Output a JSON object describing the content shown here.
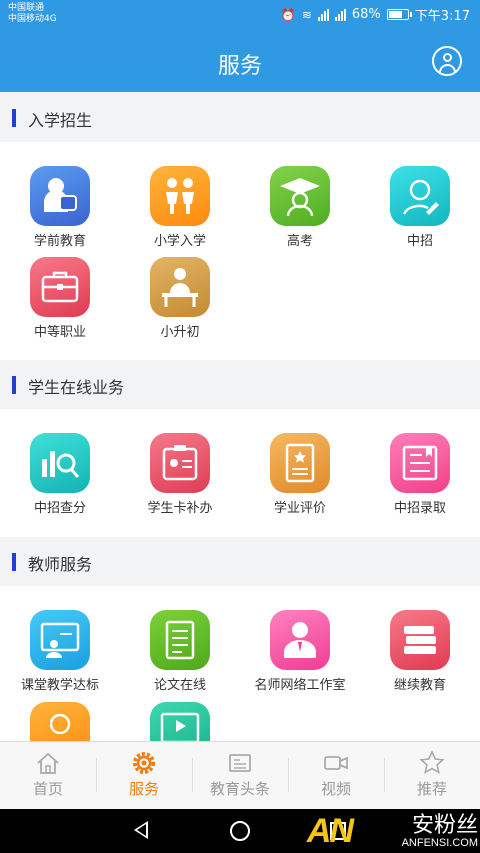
{
  "status_bar": {
    "carrier1": "中国联通",
    "carrier2": "中国移动4G",
    "battery": "68%",
    "time": "下午3:17"
  },
  "header": {
    "title": "服务"
  },
  "sections": [
    {
      "title": "入学招生",
      "items": [
        {
          "label": "学前教育",
          "icon": "preschool-icon",
          "color": "#4a7fe0"
        },
        {
          "label": "小学入学",
          "icon": "pupils-icon",
          "color": "#ffa21f"
        },
        {
          "label": "高考",
          "icon": "graduation-cap-icon",
          "color": "#6cc43a"
        },
        {
          "label": "中招",
          "icon": "pen-person-icon",
          "color": "#1fc8d0"
        },
        {
          "label": "中等职业",
          "icon": "briefcase-icon",
          "color": "#f0576a"
        },
        {
          "label": "小升初",
          "icon": "student-desk-icon",
          "color": "#d5a050"
        }
      ]
    },
    {
      "title": "学生在线业务",
      "items": [
        {
          "label": "中招查分",
          "icon": "score-search-icon",
          "color": "#1fc8c8"
        },
        {
          "label": "学生卡补办",
          "icon": "id-card-icon",
          "color": "#f0576a"
        },
        {
          "label": "学业评价",
          "icon": "certificate-icon",
          "color": "#f0a848"
        },
        {
          "label": "中招录取",
          "icon": "admission-book-icon",
          "color": "#ff5fa2"
        }
      ]
    },
    {
      "title": "教师服务",
      "items": [
        {
          "label": "课堂教学达标",
          "icon": "classroom-screen-icon",
          "color": "#22b7e8"
        },
        {
          "label": "论文在线",
          "icon": "document-icon",
          "color": "#68c42c"
        },
        {
          "label": "名师网络工作室",
          "icon": "teacher-icon",
          "color": "#ff5fa8"
        },
        {
          "label": "继续教育",
          "icon": "books-icon",
          "color": "#f0576a"
        },
        {
          "label": "",
          "icon": "person-icon",
          "color": "#ffa21f"
        },
        {
          "label": "",
          "icon": "video-icon",
          "color": "#2cc8a0"
        }
      ]
    }
  ],
  "tabs": [
    {
      "label": "首页",
      "icon": "home-icon"
    },
    {
      "label": "服务",
      "icon": "gear-icon"
    },
    {
      "label": "教育头条",
      "icon": "news-icon"
    },
    {
      "label": "视频",
      "icon": "camera-icon"
    },
    {
      "label": "推荐",
      "icon": "star-icon"
    }
  ],
  "active_tab": "服务",
  "accent_color": "#f07d12",
  "brand_color": "#2f9ae3",
  "watermark": {
    "logo": "AN",
    "cn": "安粉丝",
    "en": "ANFENSI.COM"
  }
}
